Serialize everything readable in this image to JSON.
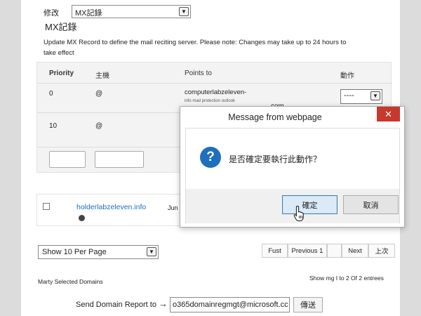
{
  "edit": {
    "label": "修改",
    "record_type": "MX記錄"
  },
  "section": {
    "title": "MX記錄",
    "description": "Update MX Record to define the mail reciting server. Please note: Changes may take up to 24 hours to take effect"
  },
  "mx_table": {
    "headers": {
      "priority": "Priority",
      "host": "主機",
      "points_to": "Points to",
      "action": "動作"
    },
    "rows": [
      {
        "priority": "0",
        "host": "@",
        "points_main": "computerlabzeleven-",
        "points_sub": "info mad protection outlook",
        "points_domain": "com",
        "action": "----"
      },
      {
        "priority": "10",
        "host": "@"
      }
    ]
  },
  "domain_row": {
    "name": "holderlabzeleven.info",
    "date": "Jun"
  },
  "pagination": {
    "per_page": "Show 10 Per Page",
    "first": "Fust",
    "previous": "Previous 1",
    "next": "Next",
    "last": "上次"
  },
  "footer": {
    "selected_domains": "Marty Selected Domains",
    "showing": "Show mg I to 2 Of 2 entrees",
    "send_report_label": "Send Domain Report to",
    "arrow": "→",
    "report_email": "o365domainregmgt@microsoft.cc",
    "send_button": "傳送"
  },
  "dialog": {
    "title": "Message from webpage",
    "close": "✕",
    "icon": "?",
    "message": "是否確定要執行此動作？",
    "ok": "確定",
    "cancel": "取消"
  },
  "colors": {
    "link": "#1a6cc7",
    "close": "#c7382d",
    "info_icon": "#1f6fbf"
  }
}
